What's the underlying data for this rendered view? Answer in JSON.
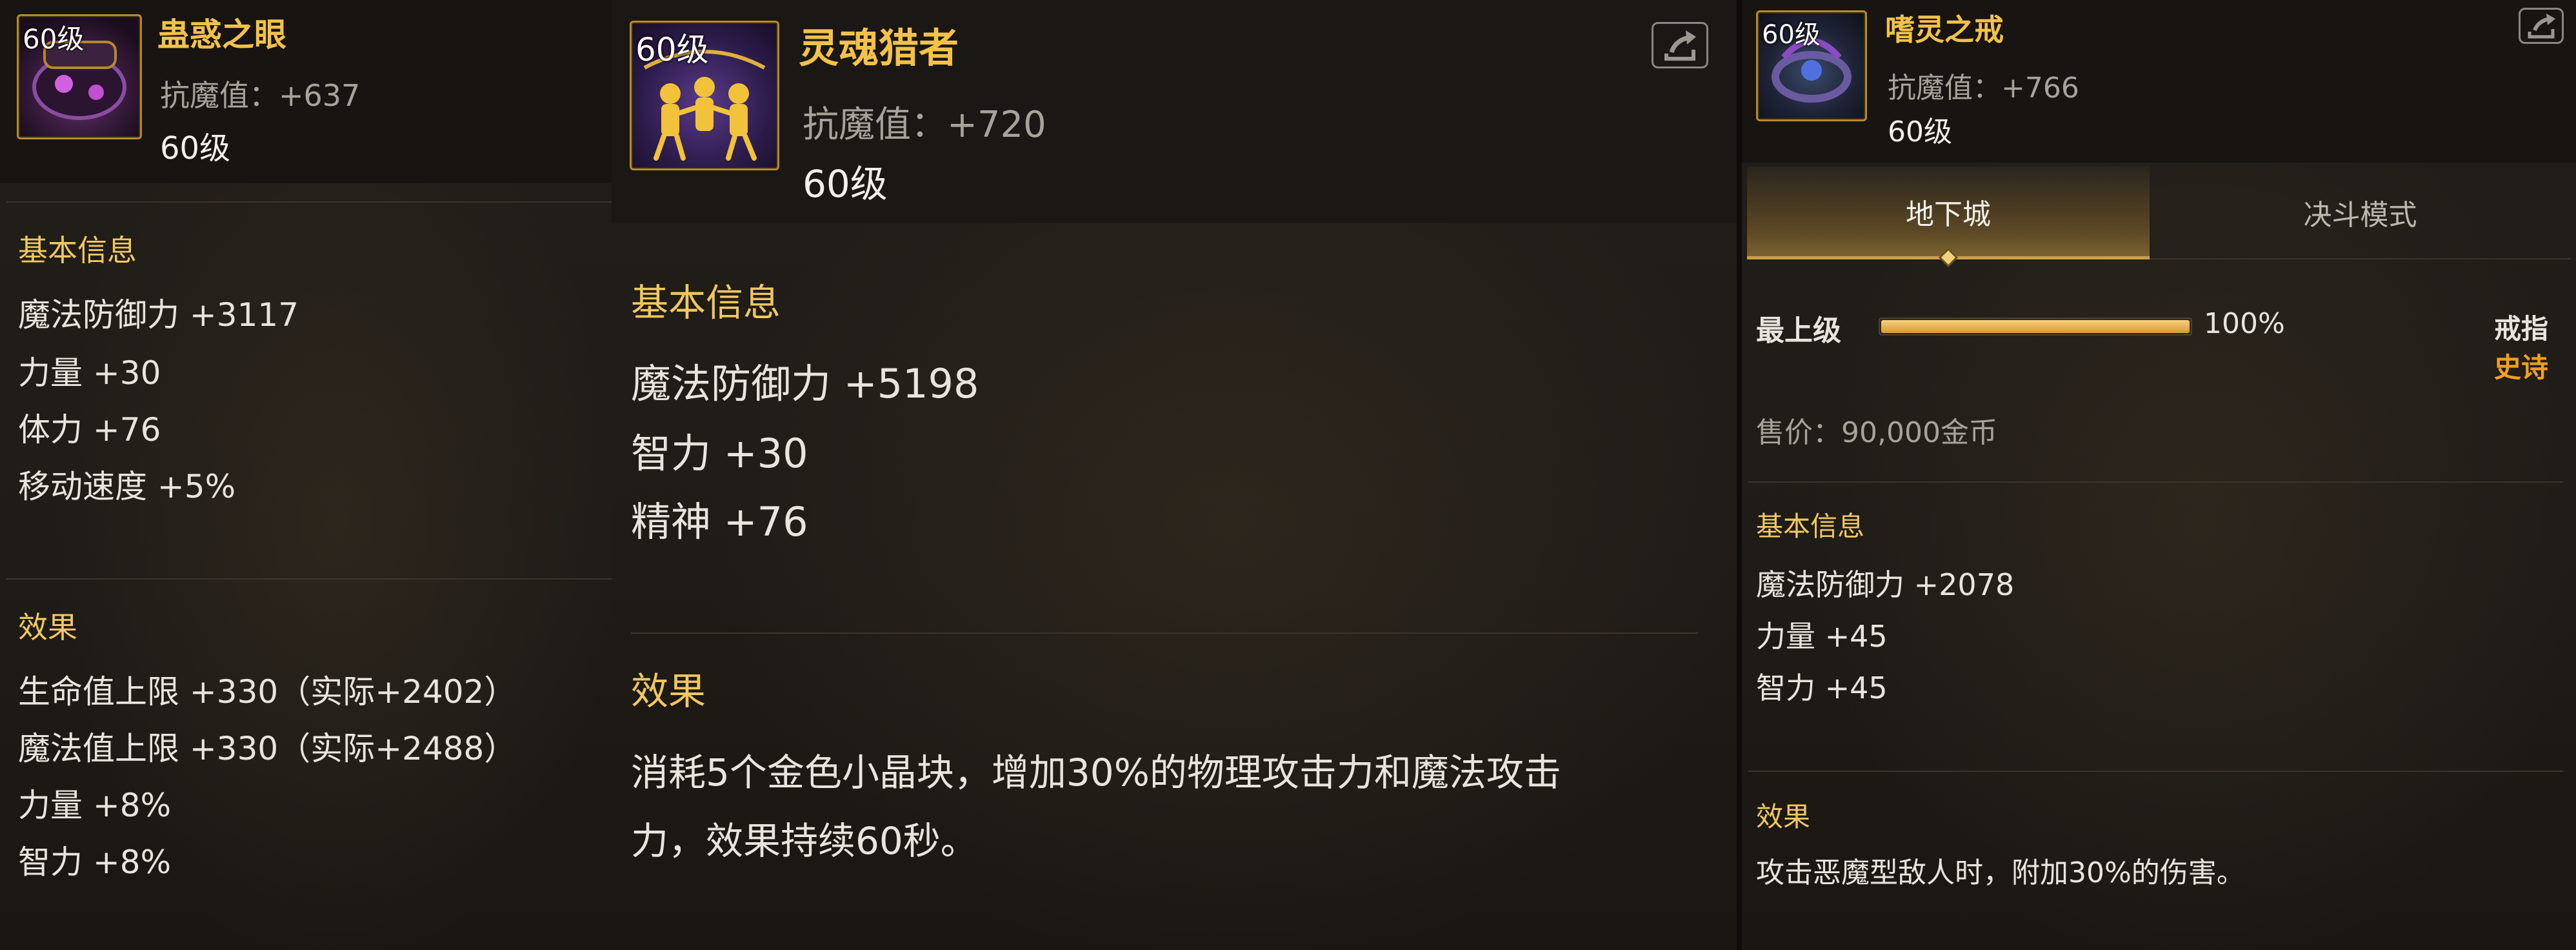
{
  "panel1": {
    "level_tag": "60级",
    "title": "蛊惑之眼",
    "magic_resist": "抗魔值：+637",
    "level": "60级",
    "basic_title": "基本信息",
    "stats": [
      "魔法防御力 +3117",
      "力量 +30",
      "体力 +76",
      "移动速度 +5%"
    ],
    "effect_title": "效果",
    "effects": [
      "生命值上限 +330（实际+2402）",
      "魔法值上限 +330（实际+2488）",
      "力量 +8%",
      "智力 +8%"
    ]
  },
  "panel2": {
    "level_tag": "60级",
    "title": "灵魂猎者",
    "magic_resist": "抗魔值：+720",
    "level": "60级",
    "basic_title": "基本信息",
    "stats": [
      "魔法防御力 +5198",
      "智力 +30",
      "精神 +76"
    ],
    "effect_title": "效果",
    "effect_text_line1": "消耗5个金色小晶块，增加30%的物理攻击力和魔法攻击",
    "effect_text_line2": "力，效果持续60秒。",
    "export_icon": "share-export-icon"
  },
  "panel3": {
    "level_tag": "60级",
    "title": "嗜灵之戒",
    "magic_resist": "抗魔值：+766",
    "level": "60级",
    "tabs": [
      {
        "label": "地下城",
        "active": true
      },
      {
        "label": "决斗模式",
        "active": false
      }
    ],
    "grade_label": "最上级",
    "grade_percent": "100%",
    "grade_fraction": 1.0,
    "item_type": "戒指",
    "rarity": "史诗",
    "price": "售价：90,000金币",
    "basic_title": "基本信息",
    "stats": [
      "魔法防御力 +2078",
      "力量 +45",
      "智力 +45"
    ],
    "effect_title": "效果",
    "effect_text": "攻击恶魔型敌人时，附加30%的伤害。",
    "export_icon": "share-export-icon"
  },
  "colors": {
    "title_gold": "#f3c24a",
    "section_gold": "#f0c860",
    "rarity_orange": "#f0a020",
    "stat_text": "#e8e5de",
    "sub_text": "#a8a39a"
  }
}
